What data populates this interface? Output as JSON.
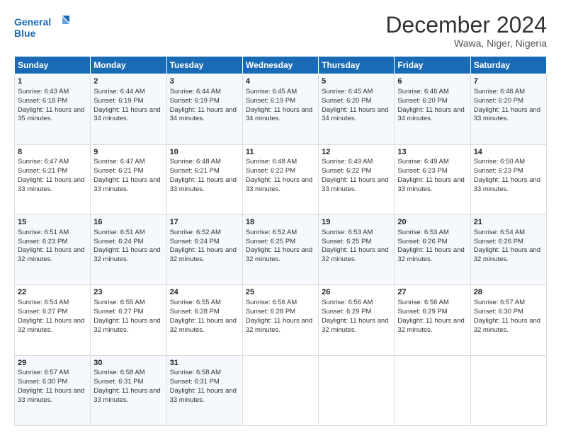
{
  "logo": {
    "line1": "General",
    "line2": "Blue"
  },
  "title": "December 2024",
  "subtitle": "Wawa, Niger, Nigeria",
  "days_of_week": [
    "Sunday",
    "Monday",
    "Tuesday",
    "Wednesday",
    "Thursday",
    "Friday",
    "Saturday"
  ],
  "weeks": [
    [
      {
        "day": "1",
        "sunrise": "6:43 AM",
        "sunset": "6:18 PM",
        "daylight": "11 hours and 35 minutes."
      },
      {
        "day": "2",
        "sunrise": "6:44 AM",
        "sunset": "6:19 PM",
        "daylight": "11 hours and 34 minutes."
      },
      {
        "day": "3",
        "sunrise": "6:44 AM",
        "sunset": "6:19 PM",
        "daylight": "11 hours and 34 minutes."
      },
      {
        "day": "4",
        "sunrise": "6:45 AM",
        "sunset": "6:19 PM",
        "daylight": "11 hours and 34 minutes."
      },
      {
        "day": "5",
        "sunrise": "6:45 AM",
        "sunset": "6:20 PM",
        "daylight": "11 hours and 34 minutes."
      },
      {
        "day": "6",
        "sunrise": "6:46 AM",
        "sunset": "6:20 PM",
        "daylight": "11 hours and 34 minutes."
      },
      {
        "day": "7",
        "sunrise": "6:46 AM",
        "sunset": "6:20 PM",
        "daylight": "11 hours and 33 minutes."
      }
    ],
    [
      {
        "day": "8",
        "sunrise": "6:47 AM",
        "sunset": "6:21 PM",
        "daylight": "11 hours and 33 minutes."
      },
      {
        "day": "9",
        "sunrise": "6:47 AM",
        "sunset": "6:21 PM",
        "daylight": "11 hours and 33 minutes."
      },
      {
        "day": "10",
        "sunrise": "6:48 AM",
        "sunset": "6:21 PM",
        "daylight": "11 hours and 33 minutes."
      },
      {
        "day": "11",
        "sunrise": "6:48 AM",
        "sunset": "6:22 PM",
        "daylight": "11 hours and 33 minutes."
      },
      {
        "day": "12",
        "sunrise": "6:49 AM",
        "sunset": "6:22 PM",
        "daylight": "11 hours and 33 minutes."
      },
      {
        "day": "13",
        "sunrise": "6:49 AM",
        "sunset": "6:23 PM",
        "daylight": "11 hours and 33 minutes."
      },
      {
        "day": "14",
        "sunrise": "6:50 AM",
        "sunset": "6:23 PM",
        "daylight": "11 hours and 33 minutes."
      }
    ],
    [
      {
        "day": "15",
        "sunrise": "6:51 AM",
        "sunset": "6:23 PM",
        "daylight": "11 hours and 32 minutes."
      },
      {
        "day": "16",
        "sunrise": "6:51 AM",
        "sunset": "6:24 PM",
        "daylight": "11 hours and 32 minutes."
      },
      {
        "day": "17",
        "sunrise": "6:52 AM",
        "sunset": "6:24 PM",
        "daylight": "11 hours and 32 minutes."
      },
      {
        "day": "18",
        "sunrise": "6:52 AM",
        "sunset": "6:25 PM",
        "daylight": "11 hours and 32 minutes."
      },
      {
        "day": "19",
        "sunrise": "6:53 AM",
        "sunset": "6:25 PM",
        "daylight": "11 hours and 32 minutes."
      },
      {
        "day": "20",
        "sunrise": "6:53 AM",
        "sunset": "6:26 PM",
        "daylight": "11 hours and 32 minutes."
      },
      {
        "day": "21",
        "sunrise": "6:54 AM",
        "sunset": "6:26 PM",
        "daylight": "11 hours and 32 minutes."
      }
    ],
    [
      {
        "day": "22",
        "sunrise": "6:54 AM",
        "sunset": "6:27 PM",
        "daylight": "11 hours and 32 minutes."
      },
      {
        "day": "23",
        "sunrise": "6:55 AM",
        "sunset": "6:27 PM",
        "daylight": "11 hours and 32 minutes."
      },
      {
        "day": "24",
        "sunrise": "6:55 AM",
        "sunset": "6:28 PM",
        "daylight": "11 hours and 32 minutes."
      },
      {
        "day": "25",
        "sunrise": "6:56 AM",
        "sunset": "6:28 PM",
        "daylight": "11 hours and 32 minutes."
      },
      {
        "day": "26",
        "sunrise": "6:56 AM",
        "sunset": "6:29 PM",
        "daylight": "11 hours and 32 minutes."
      },
      {
        "day": "27",
        "sunrise": "6:56 AM",
        "sunset": "6:29 PM",
        "daylight": "11 hours and 32 minutes."
      },
      {
        "day": "28",
        "sunrise": "6:57 AM",
        "sunset": "6:30 PM",
        "daylight": "11 hours and 32 minutes."
      }
    ],
    [
      {
        "day": "29",
        "sunrise": "6:57 AM",
        "sunset": "6:30 PM",
        "daylight": "11 hours and 33 minutes."
      },
      {
        "day": "30",
        "sunrise": "6:58 AM",
        "sunset": "6:31 PM",
        "daylight": "11 hours and 33 minutes."
      },
      {
        "day": "31",
        "sunrise": "6:58 AM",
        "sunset": "6:31 PM",
        "daylight": "11 hours and 33 minutes."
      },
      null,
      null,
      null,
      null
    ]
  ]
}
